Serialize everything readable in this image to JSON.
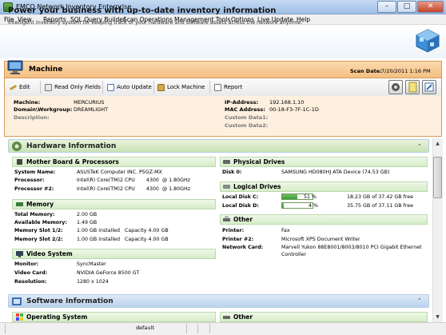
{
  "window": {
    "title": "EMCO Network Inventory Enterprise",
    "min": "–",
    "max": "□",
    "close": "✕"
  },
  "menu": [
    "File",
    "View",
    "Reports",
    "SQL Query Builder",
    "Scan Operations",
    "Management Tools",
    "Options",
    "Live Update",
    "Help"
  ],
  "banner": {
    "title": "Power your business with up-to-date inventory information",
    "subtitle": "Intelligent inventory system for keeping track of your hardware and software assets across the network anytime."
  },
  "machine": {
    "title": "Machine",
    "scan_label": "Scan Date:",
    "scan_value": "7/20/2011 1:16 PM"
  },
  "toolbar": {
    "edit": "Edit",
    "read_only": "Read Only Fields",
    "auto_update": "Auto Update",
    "lock": "Lock Machine",
    "report": "Report"
  },
  "info": {
    "machine_label": "Machine:",
    "machine_value": "MERCURIUS",
    "domain_label": "Domain\\Workgroup:",
    "domain_value": "DREAMLIGHT",
    "description_label": "Description:",
    "ip_label": "IP-Address:",
    "ip_value": "192.168.1.10",
    "mac_label": "MAC Address:",
    "mac_value": "00-18-F3-7F-1C-1D",
    "cd1_label": "Custom Data1:",
    "cd2_label": "Custom Data2:"
  },
  "hardware": {
    "title": "Hardware Information",
    "mobo": {
      "title": "Mother Board & Processors",
      "system_label": "System Name:",
      "system_value": "ASUSTeK Computer INC. P5GZ-MX",
      "proc_label": "Processor:",
      "proc_value": "Intel(R) Core(TM)2 CPU       4300  @ 1.80GHz",
      "proc2_label": "Processor #2:",
      "proc2_value": "Intel(R) Core(TM)2 CPU       4300  @ 1.80GHz"
    },
    "memory": {
      "title": "Memory",
      "total_label": "Total Memory:",
      "total_value": "2.00 GB",
      "avail_label": "Available Memory:",
      "avail_value": "1.49 GB",
      "slot1_label": "Memory Slot 1/2:",
      "slot1_value": "1.00 GB installed   Capacity 4.00 GB",
      "slot2_label": "Memory Slot 2/2:",
      "slot2_value": "1.00 GB installed   Capacity 4.00 GB"
    },
    "video": {
      "title": "Video System",
      "monitor_label": "Monitor:",
      "monitor_value": "SyncMaster",
      "card_label": "Video Card:",
      "card_value": "NVIDIA GeForce 8500 GT",
      "res_label": "Resolution:",
      "res_value": "1280 x 1024"
    },
    "physical": {
      "title": "Physical Drives",
      "disk0_label": "Disk 0:",
      "disk0_value": "SAMSUNG HD080HJ ATA Device (74.53 GB)"
    },
    "logical": {
      "title": "Logical Drives",
      "c_label": "Local Disk C:",
      "c_pct": "51 %",
      "c_fill": 51,
      "c_free": "18.23 GB of 37.42 GB free",
      "d_label": "Local Disk D:",
      "d_pct": "4 %",
      "d_fill": 4,
      "d_free": "35.75 GB of 37.11 GB free"
    },
    "other": {
      "title": "Other",
      "printer_label": "Printer:",
      "printer_value": "Fax",
      "printer2_label": "Printer #2:",
      "printer2_value": "Microsoft XPS Document Writer",
      "net_label": "Network Card:",
      "net_value_1": "Marvell Yukon 88E8001/8003/8010 PCI Gigabit Ethernet",
      "net_value_2": "Controller"
    }
  },
  "software": {
    "title": "Software Information",
    "os_title": "Operating System",
    "other_title": "Other"
  },
  "status": {
    "default": "default"
  },
  "colors": {
    "section_green": "#c9e3b6",
    "section_blue": "#bcd3ef",
    "machine_orange": "#f4bf83",
    "disk_fill": "#3e9a34"
  }
}
